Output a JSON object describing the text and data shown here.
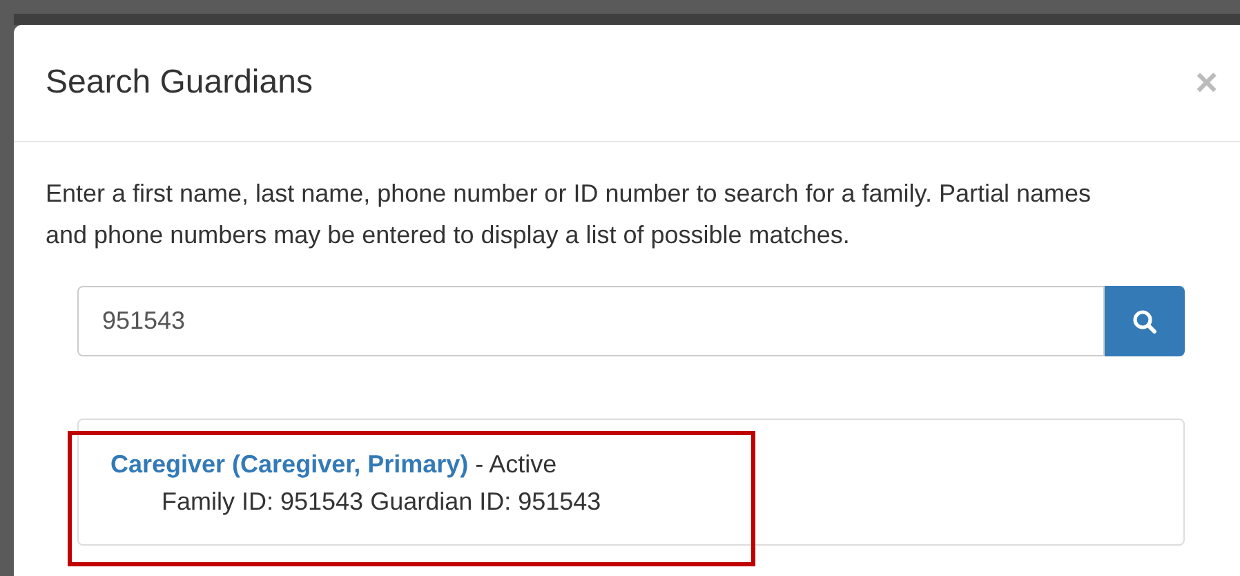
{
  "modal": {
    "title": "Search Guardians",
    "close": "×"
  },
  "instructions": "Enter a first name, last name, phone number or ID number to search for a family. Partial names and phone numbers may be entered to display a list of possible matches.",
  "search": {
    "value": "951543"
  },
  "results": [
    {
      "name": "Caregiver (Caregiver, Primary)",
      "status": "- Active",
      "details": "Family ID: 951543 Guardian ID: 951543",
      "highlighted": true
    }
  ]
}
